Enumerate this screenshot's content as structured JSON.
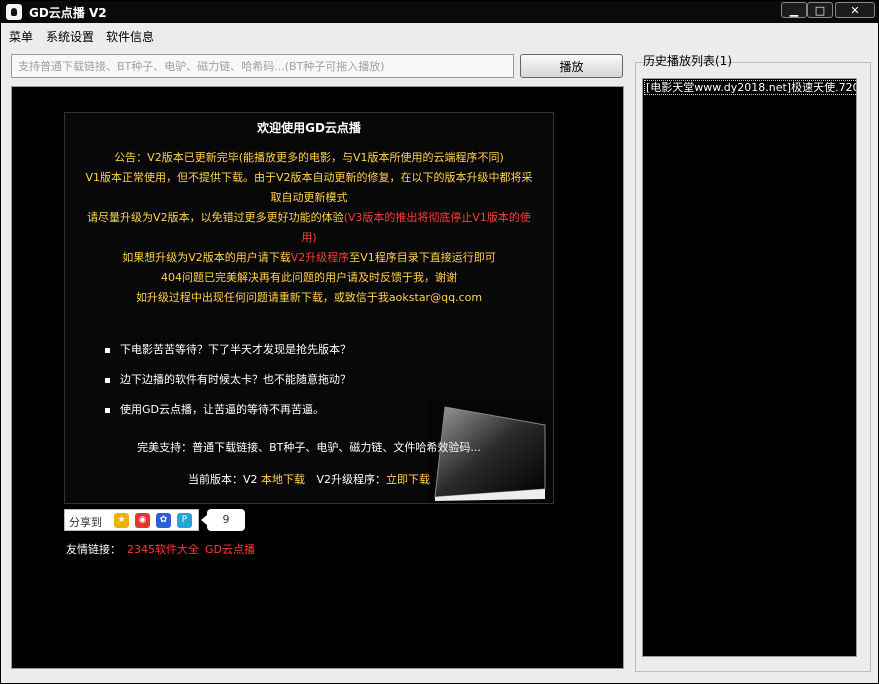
{
  "window": {
    "title": "GD云点播 V2",
    "min_glyph": "▁",
    "max_glyph": "□",
    "close_glyph": "✕"
  },
  "menu": [
    "菜单",
    "系统设置",
    "软件信息"
  ],
  "input": {
    "placeholder": "支持普通下载链接、BT种子、电驴、磁力链、哈希码...(BT种子可拖入播放)"
  },
  "play_button": "播放",
  "history": {
    "title": "历史播放列表(1)",
    "items": [
      "[电影天堂www.dy2018.net]极速天使.720"
    ]
  },
  "panel": {
    "welcome": "欢迎使用GD云点播",
    "notice_lines": [
      {
        "text": "公告：V2版本已更新完毕(能播放更多的电影，与V1版本所使用的云端程序不同)"
      },
      {
        "text": "V1版本正常使用，但不提供下载。由于V2版本自动更新的修复，在以下的版本升级中都将采"
      },
      {
        "text": "取自动更新模式"
      },
      {
        "text": "请尽量升级为V2版本，以免错过更多更好功能的体验",
        "red": "(V3版本的推出将彻底停止V1版本的使"
      },
      {
        "text": "",
        "red": "用)"
      },
      {
        "text": "如果想升级为V2版本的用户请下载",
        "red": "V2升级程序",
        "tail": "至V1程序目录下直接运行即可"
      },
      {
        "text": "404问题已完美解决再有此问题的用户请及时反馈于我，谢谢"
      },
      {
        "text": "如升级过程中出现任何问题请重新下载，或致信于我aokstar@qq.com"
      }
    ],
    "bullets": [
      "下电影苦苦等待？下了半天才发现是抢先版本？",
      "边下边播的软件有时候太卡？也不能随意拖动？",
      "使用GD云点播，让苦逼的等待不再苦逼。"
    ],
    "support": "完美支持：普通下载链接、BT种子、电驴、磁力链、文件哈希效验码...",
    "version": {
      "label": "当前版本：V2",
      "local_download": "本地下载",
      "upgrade_label": "V2升级程序：",
      "upgrade_link": "立即下载"
    }
  },
  "share": {
    "label": "分享到",
    "count": "9",
    "icons": [
      "qzone-icon",
      "weibo-icon",
      "baidu-icon",
      "pengyou-icon"
    ]
  },
  "links": {
    "label": "友情链接：",
    "items": [
      "2345软件大全",
      "GD云点播"
    ]
  },
  "colors": {
    "notice": "#ffd24a",
    "highlight": "#ff3a3a",
    "background": "#000000",
    "chrome": "#ececec"
  }
}
